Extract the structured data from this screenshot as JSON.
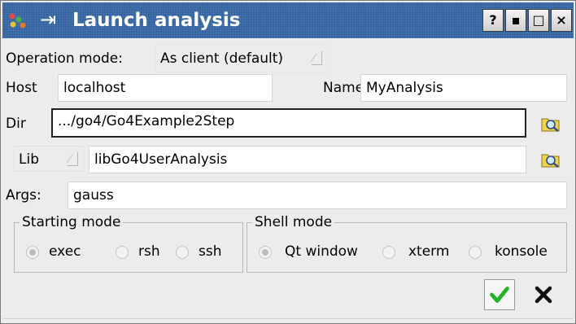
{
  "window": {
    "title": "Launch analysis",
    "pin_glyph": "⇥",
    "buttons": {
      "help": "?",
      "minimize": "▪",
      "maximize": "□",
      "close": "×"
    }
  },
  "operation": {
    "label": "Operation mode:",
    "value": "As client (default)"
  },
  "host": {
    "label": "Host",
    "value": "localhost"
  },
  "name": {
    "label": "Name",
    "value": "MyAnalysis"
  },
  "dir": {
    "label": "Dir",
    "value": ".../go4/Go4Example2Step"
  },
  "lib": {
    "combo": "Lib",
    "value": "libGo4UserAnalysis"
  },
  "args": {
    "label": "Args:",
    "value": "gauss"
  },
  "starting_mode": {
    "title": "Starting mode",
    "options": [
      "exec",
      "rsh",
      "ssh"
    ],
    "selected": "exec"
  },
  "shell_mode": {
    "title": "Shell mode",
    "options": [
      "Qt window",
      "xterm",
      "konsole"
    ],
    "selected": "Qt window"
  },
  "icons": {
    "app": "go4-app-icon",
    "pin": "pin-icon",
    "browse": "folder-browse-icon",
    "ok": "green-check-icon",
    "cancel": "black-x-icon"
  },
  "colors": {
    "titlebar": "#2d5f9e",
    "ok_check": "#22b422",
    "dialog_bg": "#ececec"
  }
}
